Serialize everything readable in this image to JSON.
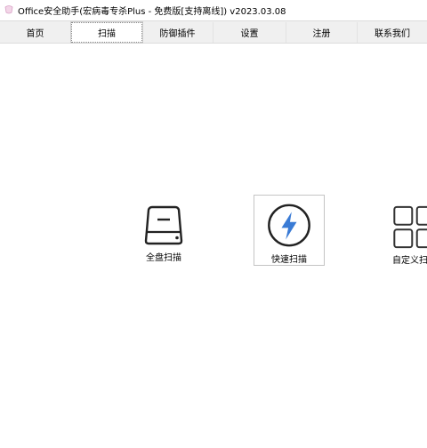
{
  "window": {
    "title": "Office安全助手(宏病毒专杀Plus - 免费版[支持离线]) v2023.03.08"
  },
  "tabs": [
    {
      "label": "首页"
    },
    {
      "label": "扫描"
    },
    {
      "label": "防御插件"
    },
    {
      "label": "设置"
    },
    {
      "label": "注册"
    },
    {
      "label": "联系我们"
    }
  ],
  "active_tab": "扫描",
  "scan_options": {
    "full_scan_label": "全盘扫描",
    "quick_scan_label": "快速扫描",
    "custom_scan_label": "自定义扫描"
  },
  "colors": {
    "accent_blue": "#3a7bd5",
    "icon_dark": "#222222"
  },
  "icons": {
    "full_scan": "hard-drive-icon",
    "quick_scan": "lightning-bolt-icon",
    "custom_scan": "grid-icon"
  }
}
